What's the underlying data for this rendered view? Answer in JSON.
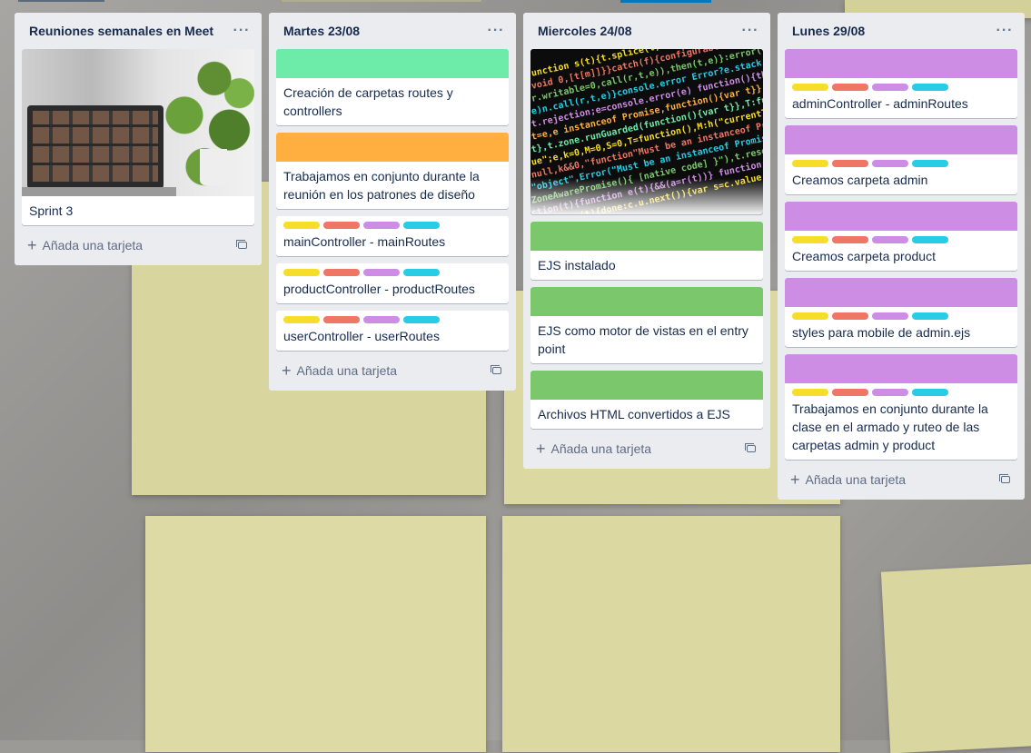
{
  "colors": {
    "list_bg": "#ebecf0",
    "label_yellow": "#f5dd29",
    "label_red": "#ef7564",
    "label_purple": "#cd8de5",
    "label_sky": "#29cce5",
    "cover_green_light": "#6deca9",
    "cover_orange": "#ffaf3f",
    "cover_green": "#7bc86c",
    "cover_purple": "#cd8de5"
  },
  "icons": {
    "list_menu": "ellipsis-icon",
    "add": "plus-icon",
    "template": "card-template-icon"
  },
  "lists": [
    {
      "title": "Reuniones semanales en Meet",
      "menu": "···",
      "add_label": "Añada una tarjeta",
      "cards": [
        {
          "title": "Sprint 3",
          "cover": "meet-photo"
        }
      ]
    },
    {
      "title": "Martes 23/08",
      "menu": "···",
      "add_label": "Añada una tarjeta",
      "cards": [
        {
          "title": "Creación de carpetas routes y controllers",
          "cover": "green-light"
        },
        {
          "title": "Trabajamos en conjunto durante la reunión en los patrones de diseño",
          "cover": "orange"
        },
        {
          "title": "mainController - mainRoutes",
          "labels": [
            "yellow",
            "red",
            "purple",
            "sky"
          ]
        },
        {
          "title": "productController - productRoutes",
          "labels": [
            "yellow",
            "red",
            "purple",
            "sky"
          ]
        },
        {
          "title": "userController - userRoutes",
          "labels": [
            "yellow",
            "red",
            "purple",
            "sky"
          ]
        }
      ]
    },
    {
      "title": "Miercoles 24/08",
      "menu": "···",
      "add_label": "Añada una tarjeta",
      "cards": [
        {
          "title": "",
          "cover": "code-photo"
        },
        {
          "title": "EJS instalado",
          "cover": "green"
        },
        {
          "title": "EJS como motor de vistas en el entry point",
          "cover": "green"
        },
        {
          "title": "Archivos HTML convertidos a EJS",
          "cover": "green"
        }
      ]
    },
    {
      "title": "Lunes 29/08",
      "menu": "···",
      "add_label": "Añada una tarjeta",
      "cards": [
        {
          "title": "adminController - adminRoutes",
          "cover": "purple",
          "labels": [
            "yellow",
            "red",
            "purple",
            "sky"
          ]
        },
        {
          "title": "Creamos carpeta admin",
          "cover": "purple",
          "labels": [
            "yellow",
            "red",
            "purple",
            "sky"
          ]
        },
        {
          "title": "Creamos carpeta product",
          "cover": "purple",
          "labels": [
            "yellow",
            "red",
            "purple",
            "sky"
          ]
        },
        {
          "title": "styles para mobile de admin.ejs",
          "cover": "purple",
          "labels": [
            "yellow",
            "red",
            "purple",
            "sky"
          ]
        },
        {
          "title": "Trabajamos en conjunto durante la clase en el armado y ruteo de las carpetas admin y product",
          "cover": "purple",
          "labels": [
            "yellow",
            "red",
            "purple",
            "sky"
          ]
        }
      ]
    }
  ]
}
